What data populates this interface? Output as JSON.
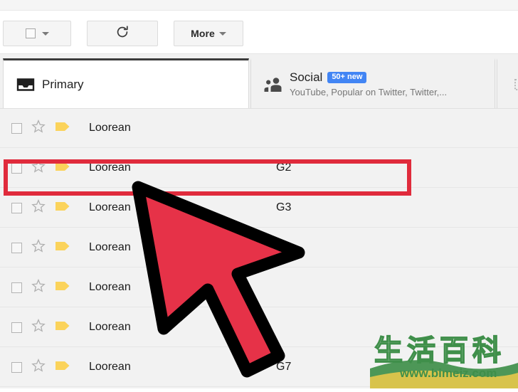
{
  "toolbar": {
    "select_all_label": "",
    "select_all_icon": "checkbox-dropdown-icon",
    "refresh_icon": "refresh-icon",
    "more_label": "More",
    "more_caret_icon": "chevron-down-icon"
  },
  "tabs": [
    {
      "id": "primary",
      "icon": "inbox-icon",
      "title": "Primary",
      "subtitle": "",
      "badge": "",
      "active": true
    },
    {
      "id": "social",
      "icon": "people-icon",
      "title": "Social",
      "subtitle": "YouTube, Popular on Twitter, Twitter,...",
      "badge": "50+ new",
      "active": false
    },
    {
      "id": "promotions-partial",
      "icon": "tag-icon",
      "title": "",
      "subtitle": "",
      "badge": "",
      "active": false
    }
  ],
  "mail_rows": [
    {
      "sender": "Loorean",
      "label": "",
      "checkbox_icon": "checkbox-icon",
      "star_icon": "star-outline-icon",
      "tag_icon": "label-tag-icon"
    },
    {
      "sender": "Loorean",
      "label": "G2",
      "checkbox_icon": "checkbox-icon",
      "star_icon": "star-outline-icon",
      "tag_icon": "label-tag-icon"
    },
    {
      "sender": "Loorean",
      "label": "G3",
      "checkbox_icon": "checkbox-icon",
      "star_icon": "star-outline-icon",
      "tag_icon": "label-tag-icon"
    },
    {
      "sender": "Loorean",
      "label": "",
      "checkbox_icon": "checkbox-icon",
      "star_icon": "star-outline-icon",
      "tag_icon": "label-tag-icon"
    },
    {
      "sender": "Loorean",
      "label": "",
      "checkbox_icon": "checkbox-icon",
      "star_icon": "star-outline-icon",
      "tag_icon": "label-tag-icon"
    },
    {
      "sender": "Loorean",
      "label": "",
      "checkbox_icon": "checkbox-icon",
      "star_icon": "star-outline-icon",
      "tag_icon": "label-tag-icon"
    },
    {
      "sender": "Loorean",
      "label": "G7",
      "checkbox_icon": "checkbox-icon",
      "star_icon": "star-outline-icon",
      "tag_icon": "label-tag-icon"
    }
  ],
  "annotation": {
    "highlight_row_index": 1,
    "highlight_color": "#e02b3c",
    "cursor_icon": "arrow-cursor",
    "cursor_fill": "#e63248",
    "cursor_stroke": "#000000"
  },
  "watermark": {
    "cjk_text": "生活百科",
    "url_text": "www.bimeiz.com",
    "color": "#3f8f4a"
  },
  "colors": {
    "badge_blue": "#4285f4",
    "tag_yellow": "#fbd35b",
    "row_background": "#f2f2f2",
    "tab_active_border": "#3c3c3c"
  }
}
